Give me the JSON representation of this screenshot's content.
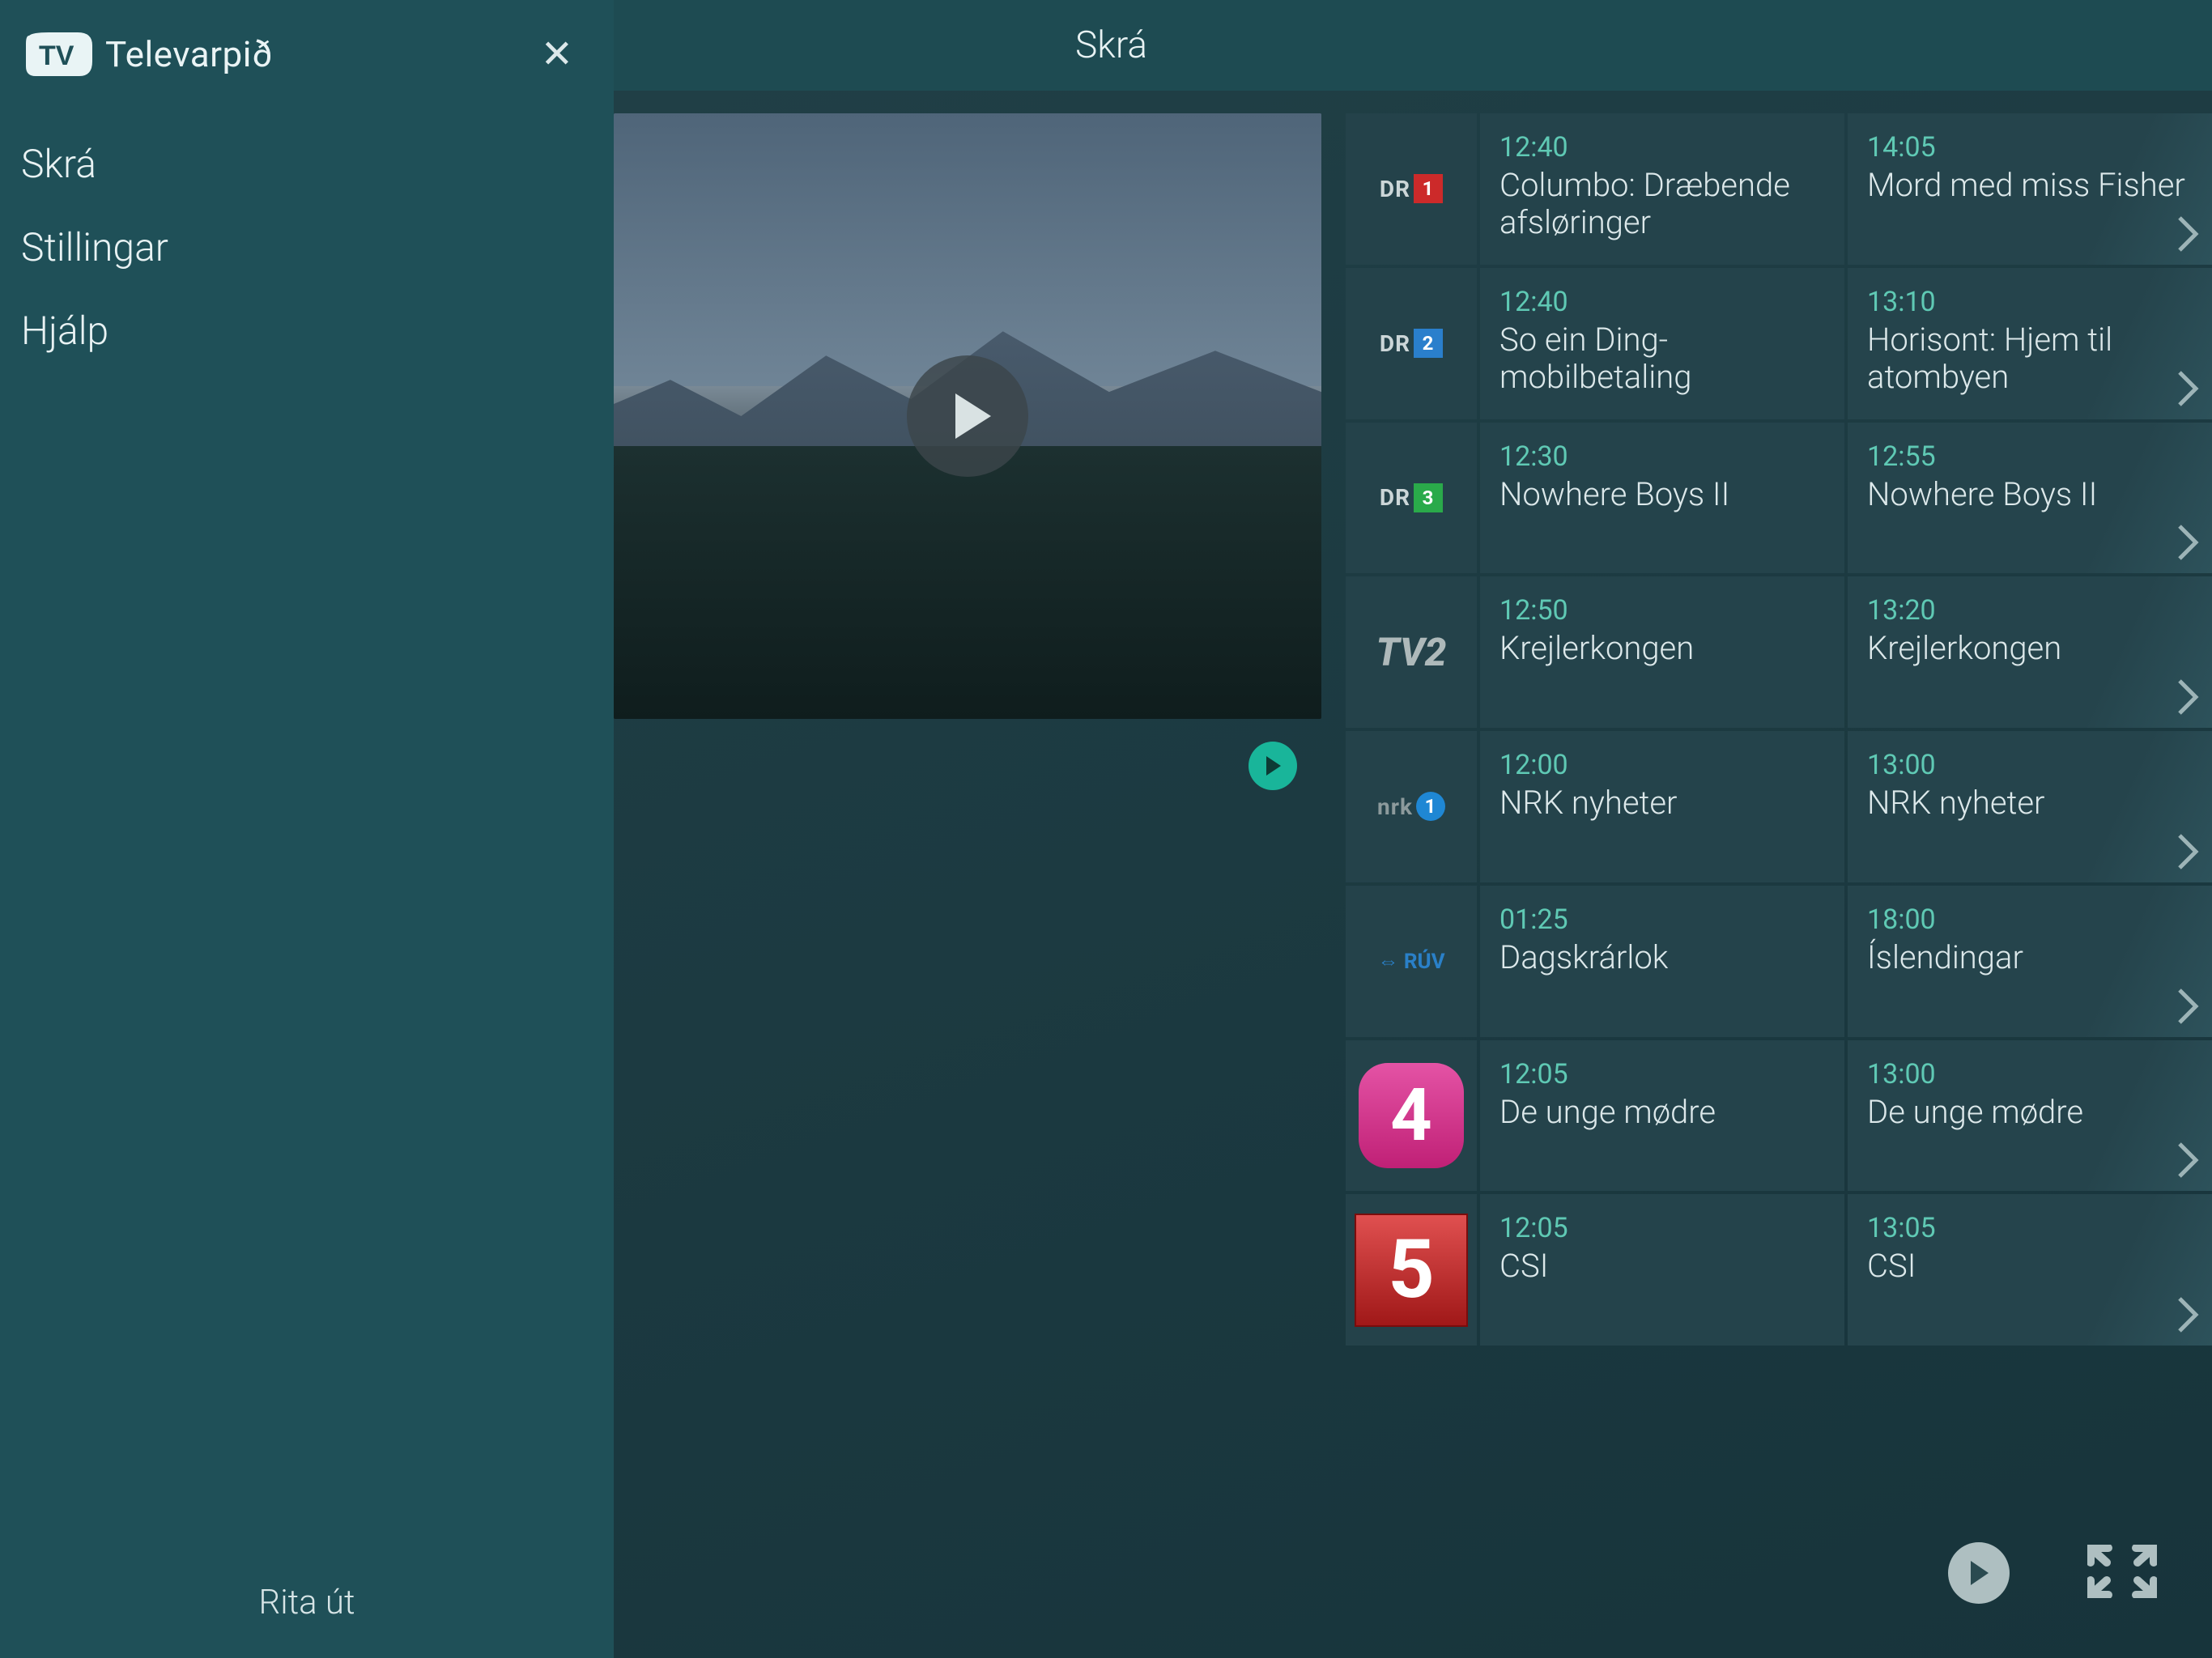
{
  "header": {
    "title": "Skrá"
  },
  "sidebar": {
    "brand": "Televarpið",
    "nav": [
      {
        "label": "Skrá"
      },
      {
        "label": "Stillingar"
      },
      {
        "label": "Hjálp"
      }
    ],
    "logout": "Rita út"
  },
  "channels": [
    {
      "logo": {
        "kind": "dr",
        "text": "DR",
        "num": "1"
      },
      "now": {
        "time": "12:40",
        "title": "Columbo: Dræbende afsløringer"
      },
      "next": {
        "time": "14:05",
        "title": "Mord med miss Fisher"
      }
    },
    {
      "logo": {
        "kind": "dr2",
        "text": "DR",
        "num": "2"
      },
      "now": {
        "time": "12:40",
        "title": "So ein Ding-mobilbetaling"
      },
      "next": {
        "time": "13:10",
        "title": "Horisont: Hjem til atombyen"
      }
    },
    {
      "logo": {
        "kind": "dr3",
        "text": "DR",
        "num": "3"
      },
      "now": {
        "time": "12:30",
        "title": "Nowhere Boys II"
      },
      "next": {
        "time": "12:55",
        "title": "Nowhere Boys II"
      }
    },
    {
      "logo": {
        "kind": "tv2",
        "text": "TV2"
      },
      "now": {
        "time": "12:50",
        "title": "Krejlerkongen"
      },
      "next": {
        "time": "13:20",
        "title": "Krejlerkongen"
      }
    },
    {
      "logo": {
        "kind": "nrk1",
        "text": "nrk",
        "num": "1"
      },
      "now": {
        "time": "12:00",
        "title": "NRK nyheter"
      },
      "next": {
        "time": "13:00",
        "title": "NRK nyheter"
      }
    },
    {
      "logo": {
        "kind": "ruv",
        "text": "⇔ RÚV"
      },
      "now": {
        "time": "01:25",
        "title": "Dagskrárlok"
      },
      "next": {
        "time": "18:00",
        "title": "Íslendingar"
      }
    },
    {
      "logo": {
        "kind": "kanal4",
        "text": "4"
      },
      "now": {
        "time": "12:05",
        "title": "De unge mødre"
      },
      "next": {
        "time": "13:00",
        "title": "De unge mødre"
      }
    },
    {
      "logo": {
        "kind": "kanal5",
        "text": "5"
      },
      "now": {
        "time": "12:05",
        "title": "CSI"
      },
      "next": {
        "time": "13:05",
        "title": "CSI"
      }
    }
  ]
}
